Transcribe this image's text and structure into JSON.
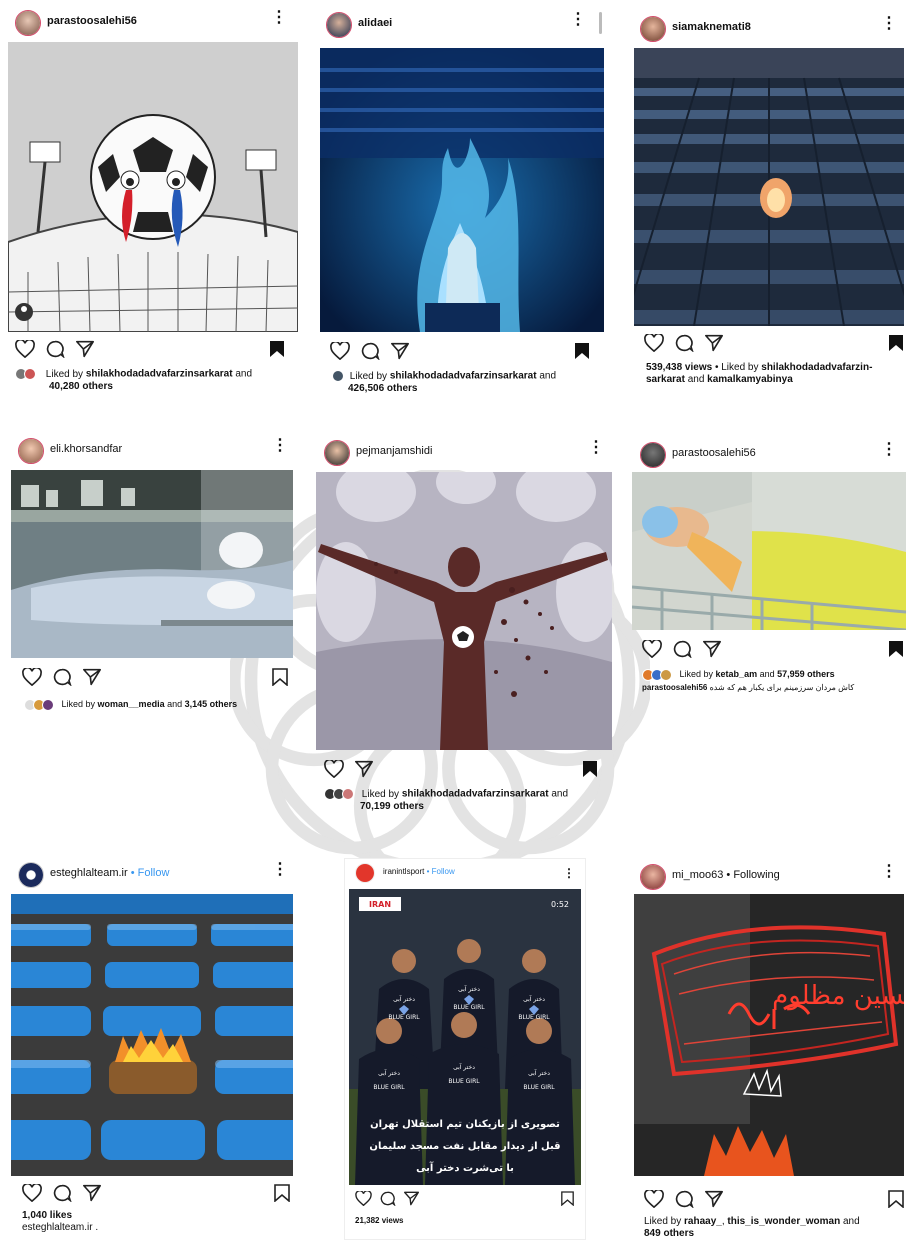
{
  "posts": [
    {
      "username": "parastoosalehi56",
      "follow": "",
      "likes_prefix": "Liked by ",
      "likes_user": "shilakhodadadvafarzinsarkarat",
      "likes_mid": " and",
      "likes_count": "40,280 others",
      "caption": ""
    },
    {
      "username": "alidaei",
      "follow": "",
      "likes_prefix": "Liked by ",
      "likes_user": "shilakhodadadvafarzinsarkarat",
      "likes_mid": " and",
      "likes_count": "426,506 others",
      "caption": ""
    },
    {
      "username": "siamaknemati8",
      "follow": "",
      "views": "539,438 views",
      "likes_prefix": " • Liked by ",
      "likes_user": "shilakhodadadvafarzin-",
      "likes_user2": "sarkarat",
      "likes_mid": " and ",
      "likes_user3": "kamalkamyabinya",
      "caption": ""
    },
    {
      "username": "eli.khorsandfar",
      "follow": "",
      "likes_prefix": "Liked by ",
      "likes_user": "woman__media",
      "likes_mid": " and ",
      "likes_count": "3,145 others",
      "caption": ""
    },
    {
      "username": "pejmanjamshidi",
      "follow": "",
      "likes_prefix": "Liked by ",
      "likes_user": "shilakhodadadvafarzinsarkarat",
      "likes_mid": " and",
      "likes_count": "70,199 others",
      "caption": ""
    },
    {
      "username": "parastoosalehi56",
      "follow": "",
      "likes_prefix": "Liked by ",
      "likes_user": "ketab_am",
      "likes_mid": " and ",
      "likes_count": "57,959 others",
      "caption_user": "parastoosalehi56",
      "caption": " کاش مردان سرزمینم برای یکبار هم که شده"
    },
    {
      "username": "esteghlalteam.ir",
      "follow": " • Follow",
      "likes_count": "1,040 likes",
      "caption_user": "esteghlalteam.ir",
      "caption": " ."
    },
    {
      "username": "iranintlsport",
      "follow": " • Follow",
      "views": "21,382 views",
      "video_time": "0:52",
      "overlay_logo": "IRAN",
      "overlay_line1": "تصویری از بازیکنان تیم استقلال تهران",
      "overlay_line2": "قبل از دیدار مقابل نفت مسجد سلیمان",
      "overlay_line3": "با تی‌شرت دختر آبی",
      "shirt_text": "دختر آبی",
      "shirt_sub": "BLUE GIRL"
    },
    {
      "username": "mi_moo63",
      "follow": " • Following",
      "likes_prefix": "Liked by ",
      "likes_user": "rahaay_",
      "likes_mid": ", ",
      "likes_user2": "this_is_wonder_woman",
      "likes_mid2": " and",
      "likes_count": "849 others",
      "flag_text": "یاحسین مظلوم"
    }
  ],
  "icons": [
    "heart-icon",
    "comment-icon",
    "share-icon",
    "bookmark-icon",
    "more-icon"
  ]
}
